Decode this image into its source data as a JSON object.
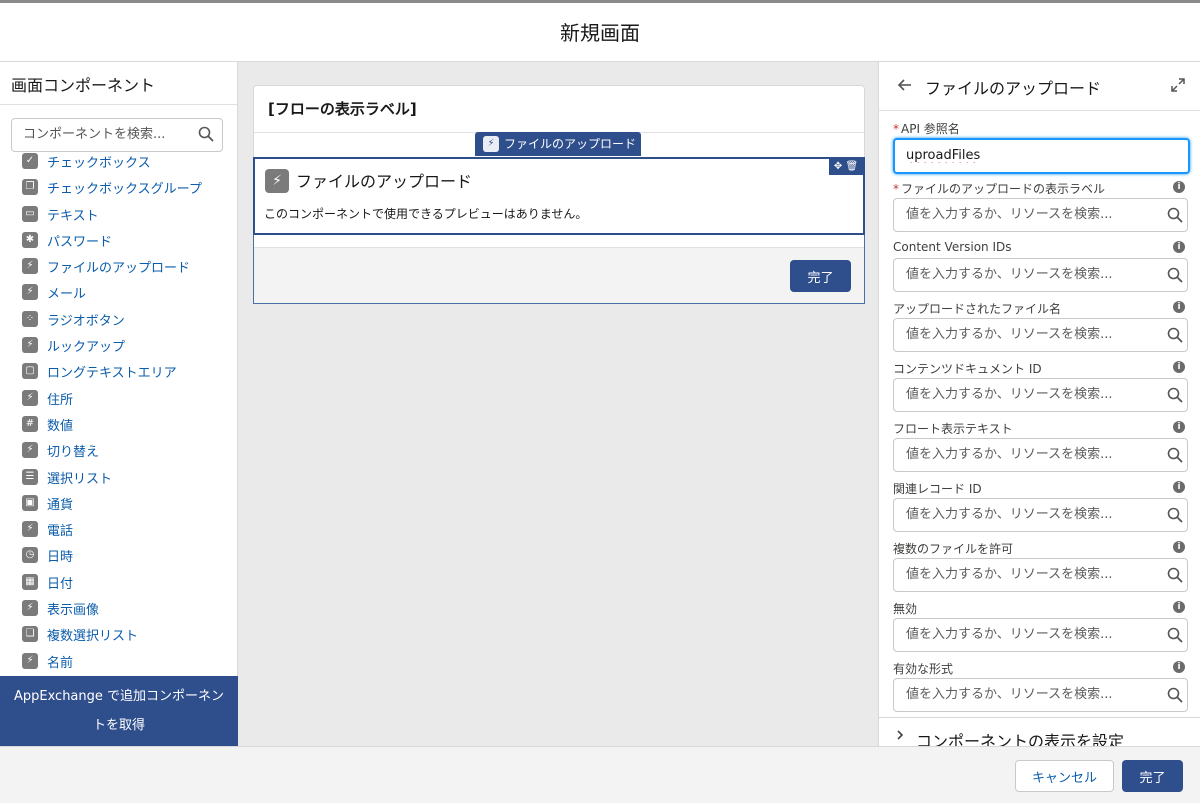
{
  "header": {
    "title": "新規画面"
  },
  "left_panel": {
    "title": "画面コンポーネント",
    "search_placeholder": "コンポーネントを検索...",
    "components": [
      {
        "label": "チェックボックス",
        "icon": "checkbox-icon",
        "glyph": "✓"
      },
      {
        "label": "チェックボックスグループ",
        "icon": "checkbox-group-icon",
        "glyph": "❐"
      },
      {
        "label": "テキスト",
        "icon": "text-icon",
        "glyph": "▭"
      },
      {
        "label": "パスワード",
        "icon": "password-icon",
        "glyph": "✱"
      },
      {
        "label": "ファイルのアップロード",
        "icon": "lightning-icon",
        "glyph": "⚡"
      },
      {
        "label": "メール",
        "icon": "lightning-icon",
        "glyph": "⚡"
      },
      {
        "label": "ラジオボタン",
        "icon": "radio-icon",
        "glyph": "⁘"
      },
      {
        "label": "ルックアップ",
        "icon": "lightning-icon",
        "glyph": "⚡"
      },
      {
        "label": "ロングテキストエリア",
        "icon": "textarea-icon",
        "glyph": "▢"
      },
      {
        "label": "住所",
        "icon": "lightning-icon",
        "glyph": "⚡"
      },
      {
        "label": "数値",
        "icon": "number-icon",
        "glyph": "#"
      },
      {
        "label": "切り替え",
        "icon": "lightning-icon",
        "glyph": "⚡"
      },
      {
        "label": "選択リスト",
        "icon": "picklist-icon",
        "glyph": "☰"
      },
      {
        "label": "通貨",
        "icon": "currency-icon",
        "glyph": "▣"
      },
      {
        "label": "電話",
        "icon": "lightning-icon",
        "glyph": "⚡"
      },
      {
        "label": "日時",
        "icon": "datetime-icon",
        "glyph": "◷"
      },
      {
        "label": "日付",
        "icon": "date-icon",
        "glyph": "▦"
      },
      {
        "label": "表示画像",
        "icon": "lightning-icon",
        "glyph": "⚡"
      },
      {
        "label": "複数選択リスト",
        "icon": "multiselect-icon",
        "glyph": "❏"
      },
      {
        "label": "名前",
        "icon": "lightning-icon",
        "glyph": "⚡"
      }
    ],
    "appexchange_label": "AppExchange で追加コンポーネントを取得"
  },
  "canvas": {
    "card_title": "[フローの表示ラベル]",
    "selected_tag": "ファイルのアップロード",
    "component_title": "ファイルのアップロード",
    "preview_text": "このコンポーネントで使用できるプレビューはありません。",
    "controls_glyph": "✥ 🗑",
    "done_label": "完了"
  },
  "right_panel": {
    "title": "ファイルのアップロード",
    "fields": [
      {
        "label": "API 参照名",
        "required": true,
        "info": false,
        "value": "uproadFiles",
        "placeholder": ""
      },
      {
        "label": "ファイルのアップロードの表示ラベル",
        "required": true,
        "info": true,
        "value": "",
        "placeholder": "値を入力するか、リソースを検索..."
      },
      {
        "label": "Content Version IDs",
        "required": false,
        "info": true,
        "value": "",
        "placeholder": "値を入力するか、リソースを検索..."
      },
      {
        "label": "アップロードされたファイル名",
        "required": false,
        "info": true,
        "value": "",
        "placeholder": "値を入力するか、リソースを検索..."
      },
      {
        "label": "コンテンツドキュメント ID",
        "required": false,
        "info": true,
        "value": "",
        "placeholder": "値を入力するか、リソースを検索..."
      },
      {
        "label": "フロート表示テキスト",
        "required": false,
        "info": true,
        "value": "",
        "placeholder": "値を入力するか、リソースを検索..."
      },
      {
        "label": "関連レコード ID",
        "required": false,
        "info": true,
        "value": "",
        "placeholder": "値を入力するか、リソースを検索..."
      },
      {
        "label": "複数のファイルを許可",
        "required": false,
        "info": true,
        "value": "",
        "placeholder": "値を入力するか、リソースを検索..."
      },
      {
        "label": "無効",
        "required": false,
        "info": true,
        "value": "",
        "placeholder": "値を入力するか、リソースを検索..."
      },
      {
        "label": "有効な形式",
        "required": false,
        "info": true,
        "value": "",
        "placeholder": "値を入力するか、リソースを検索..."
      }
    ],
    "visibility_label": "コンポーネントの表示を設定"
  },
  "footer": {
    "cancel_label": "キャンセル",
    "done_label": "完了"
  },
  "colors": {
    "brand": "#2f4e8c",
    "link": "#0b5cab",
    "focus": "#1b96ff",
    "required": "#c23934"
  }
}
